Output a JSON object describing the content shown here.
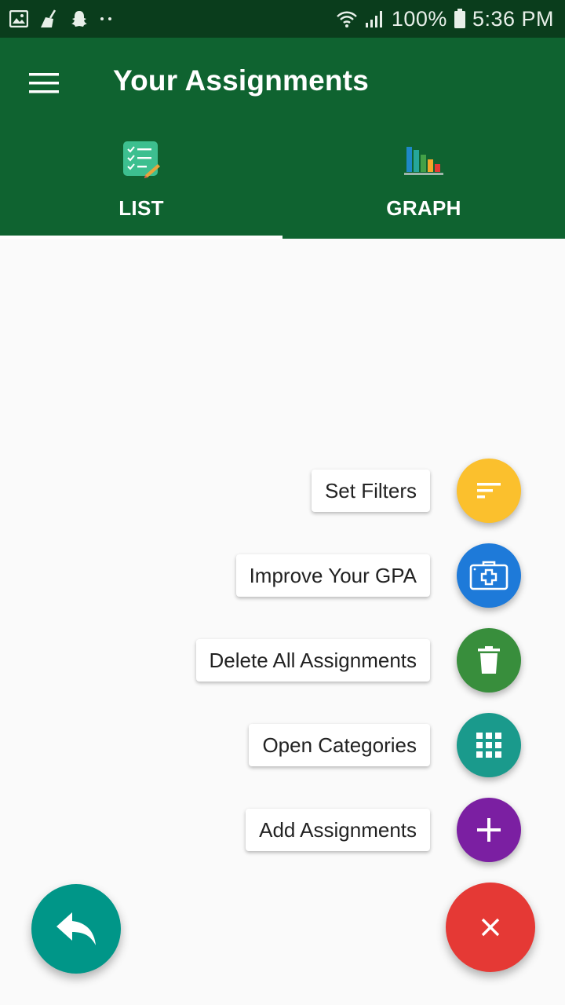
{
  "status_bar": {
    "battery": "100%",
    "time": "5:36 PM",
    "icons": [
      "gallery-icon",
      "cleaner-icon",
      "snapchat-icon",
      "more-dots-icon",
      "wifi-icon",
      "signal-icon",
      "battery-icon"
    ]
  },
  "app_bar": {
    "title": "Your Assignments",
    "menu_icon": "hamburger-menu-icon"
  },
  "tabs": [
    {
      "label": "LIST",
      "icon": "checklist-icon",
      "selected": true
    },
    {
      "label": "GRAPH",
      "icon": "bar-chart-icon",
      "selected": false
    }
  ],
  "speed_dial": {
    "actions": [
      {
        "label": "Set Filters",
        "icon": "filter-icon",
        "color": "#fbc02d"
      },
      {
        "label": "Improve Your GPA",
        "icon": "medical-kit-icon",
        "color": "#1e7ad9"
      },
      {
        "label": "Delete All Assignments",
        "icon": "trash-icon",
        "color": "#388e3c"
      },
      {
        "label": "Open Categories",
        "icon": "grid-icon",
        "color": "#1a9a8c"
      },
      {
        "label": "Add Assignments",
        "icon": "plus-icon",
        "color": "#7b1fa2"
      }
    ]
  },
  "fabs": {
    "back": {
      "icon": "reply-arrow-icon",
      "color": "#009688"
    },
    "close": {
      "icon": "close-icon",
      "color": "#e53935"
    }
  },
  "colors": {
    "status_bar": "#0a3d1c",
    "app_bar": "#0f6330",
    "background": "#fafafa"
  }
}
